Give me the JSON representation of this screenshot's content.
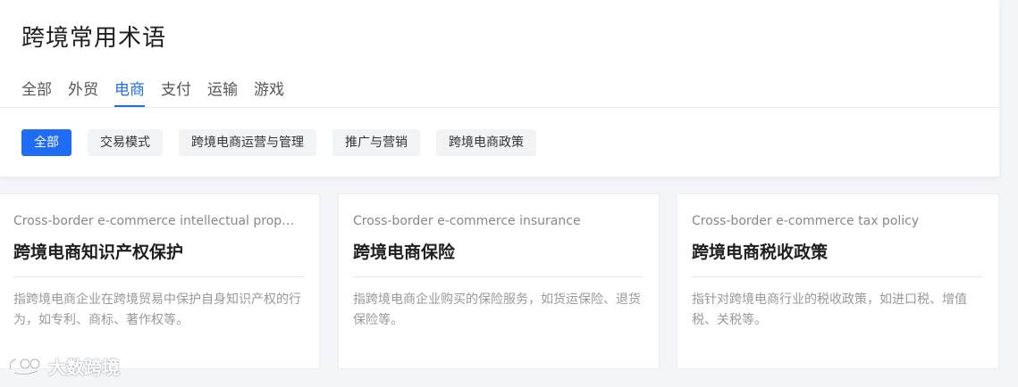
{
  "page": {
    "title": "跨境常用术语"
  },
  "tabs": [
    {
      "label": "全部",
      "active": false
    },
    {
      "label": "外贸",
      "active": false
    },
    {
      "label": "电商",
      "active": true
    },
    {
      "label": "支付",
      "active": false
    },
    {
      "label": "运输",
      "active": false
    },
    {
      "label": "游戏",
      "active": false
    }
  ],
  "filters": [
    {
      "label": "全部",
      "active": true
    },
    {
      "label": "交易模式",
      "active": false
    },
    {
      "label": "跨境电商运营与管理",
      "active": false
    },
    {
      "label": "推广与营销",
      "active": false
    },
    {
      "label": "跨境电商政策",
      "active": false
    }
  ],
  "cards": [
    {
      "english": "Cross-border e-commerce intellectual property protection",
      "title": "跨境电商知识产权保护",
      "description": "指跨境电商企业在跨境贸易中保护自身知识产权的行为，如专利、商标、著作权等。"
    },
    {
      "english": "Cross-border e-commerce insurance",
      "title": "跨境电商保险",
      "description": "指跨境电商企业购买的保险服务，如货运保险、退货保险等。"
    },
    {
      "english": "Cross-border e-commerce tax policy",
      "title": "跨境电商税收政策",
      "description": "指针对跨境电商行业的税收政策，如进口税、增值税、关税等。"
    }
  ],
  "watermark": {
    "text": "大数跨境"
  },
  "colors": {
    "accent": "#1f6cf5",
    "background": "#f3f5f8"
  }
}
